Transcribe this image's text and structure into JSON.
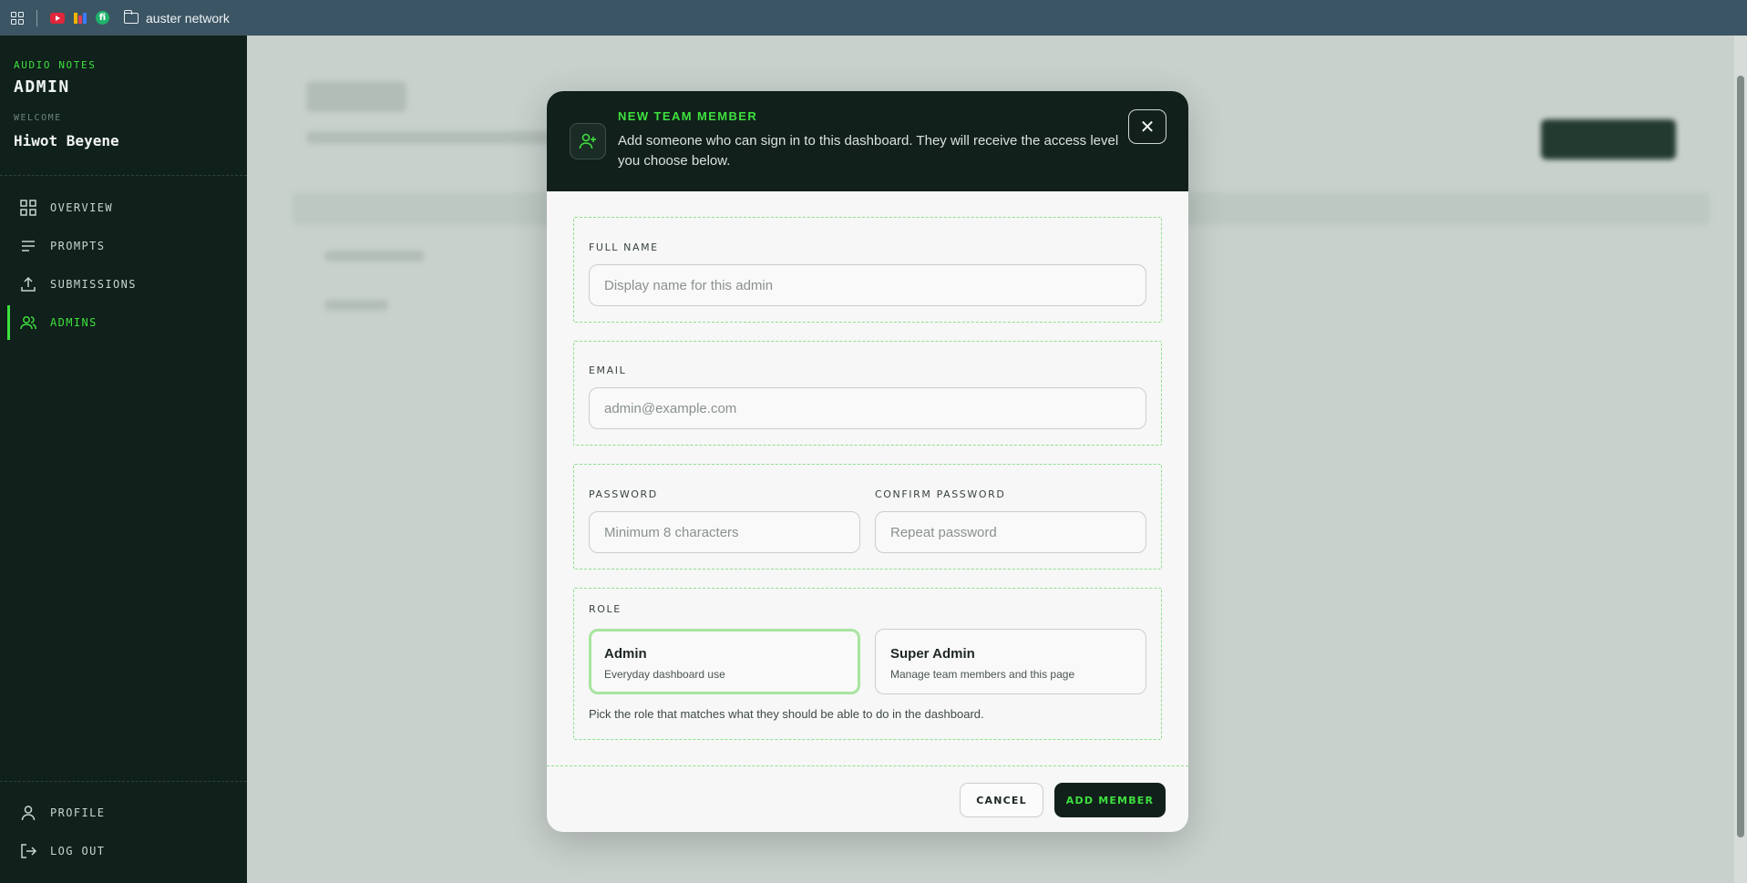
{
  "browser": {
    "bookmark_folder": "auster network",
    "icons": [
      "apps-grid-icon",
      "youtube-icon",
      "miro-icon",
      "green-circle-icon",
      "folder-icon"
    ]
  },
  "sidebar": {
    "subtitle": "AUDIO NOTES",
    "title": "ADMIN",
    "welcome_label": "WELCOME",
    "user_name": "Hiwot Beyene",
    "nav": [
      {
        "label": "OVERVIEW",
        "icon": "grid-icon",
        "active": false
      },
      {
        "label": "PROMPTS",
        "icon": "lines-icon",
        "active": false
      },
      {
        "label": "SUBMISSIONS",
        "icon": "upload-icon",
        "active": false
      },
      {
        "label": "ADMINS",
        "icon": "users-icon",
        "active": true
      }
    ],
    "bottom": [
      {
        "label": "PROFILE",
        "icon": "user-icon"
      },
      {
        "label": "LOG OUT",
        "icon": "logout-icon"
      }
    ]
  },
  "modal": {
    "title": "NEW TEAM MEMBER",
    "description": "Add someone who can sign in to this dashboard. They will receive the access level you choose below.",
    "close_glyph": "✕",
    "full_name": {
      "label": "FULL NAME",
      "placeholder": "Display name for this admin",
      "value": ""
    },
    "email": {
      "label": "EMAIL",
      "placeholder": "admin@example.com",
      "value": ""
    },
    "password": {
      "label": "PASSWORD",
      "placeholder": "Minimum 8 characters",
      "value": ""
    },
    "confirm_password": {
      "label": "CONFIRM PASSWORD",
      "placeholder": "Repeat password",
      "value": ""
    },
    "role": {
      "label": "ROLE",
      "selected": "Admin",
      "options": [
        {
          "title": "Admin",
          "description": "Everyday dashboard use"
        },
        {
          "title": "Super Admin",
          "description": "Manage team members and this page"
        }
      ],
      "hint": "Pick the role that matches what they should be able to do in the dashboard."
    },
    "cancel_label": "CANCEL",
    "submit_label": "ADD MEMBER"
  },
  "colors": {
    "accent": "#3ee03e",
    "dark": "#11201b",
    "topbar": "#3c5564",
    "dashed_border": "#8ee08e",
    "selected_border": "#a8e4a0"
  }
}
